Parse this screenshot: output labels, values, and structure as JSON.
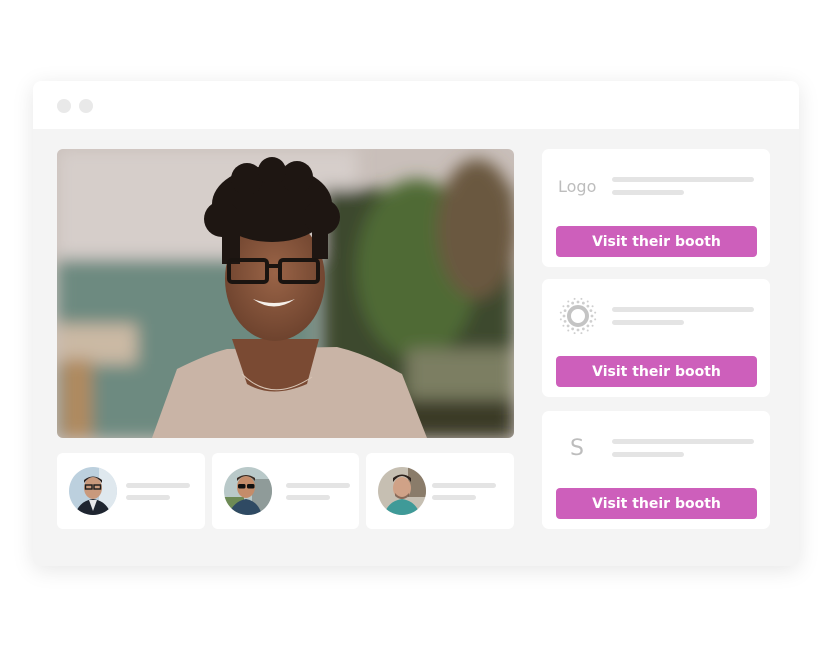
{
  "window": {
    "controls": [
      "window-dot",
      "window-dot"
    ]
  },
  "main_video": {
    "description": "Smiling woman with curly hair and black glasses in a blurred room with plants"
  },
  "attendees": [
    {
      "description": "Man with glasses in dark blazer"
    },
    {
      "description": "Man with sunglasses outdoors"
    },
    {
      "description": "Man with beard in teal shirt"
    }
  ],
  "booths": [
    {
      "logo_type": "text",
      "logo_text": "Logo",
      "button_label": "Visit their booth"
    },
    {
      "logo_type": "sunburst-icon",
      "logo_text": "",
      "button_label": "Visit their booth"
    },
    {
      "logo_type": "letter",
      "logo_text": "S",
      "button_label": "Visit their booth"
    }
  ],
  "colors": {
    "accent": "#cd5fbb",
    "placeholder_line": "#e4e4e4",
    "window_bg": "#f4f4f4",
    "logo_gray": "#bdbdbd"
  }
}
